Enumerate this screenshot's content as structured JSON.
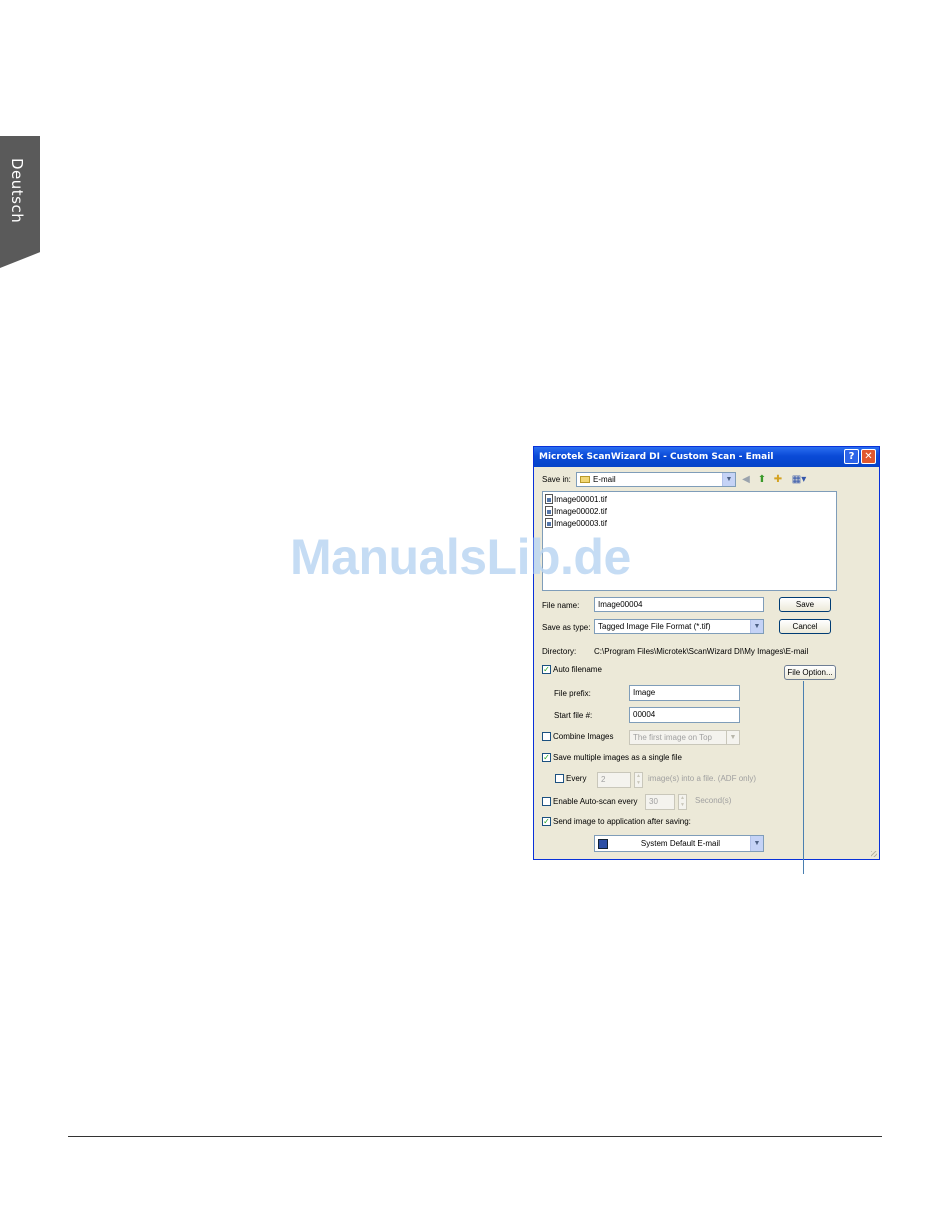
{
  "side_tab": {
    "label": "Deutsch"
  },
  "watermark": "ManualsLib.de",
  "dialog": {
    "title": "Microtek ScanWizard DI - Custom Scan - Email",
    "help_label": "?",
    "close_label": "✕",
    "save_in_label": "Save in:",
    "save_in_value": "E-mail",
    "files": [
      "Image00001.tif",
      "Image00002.tif",
      "Image00003.tif"
    ],
    "file_name_label": "File name:",
    "file_name_value": "Image00004",
    "save_button": "Save",
    "save_as_type_label": "Save as type:",
    "save_as_type_value": "Tagged Image File Format (*.tif)",
    "cancel_button": "Cancel",
    "directory_label": "Directory:",
    "directory_value": "C:\\Program Files\\Microtek\\ScanWizard DI\\My Images\\E-mail",
    "auto_filename_label": "Auto filename",
    "auto_filename_checked": true,
    "file_option_button": "File Option...",
    "file_prefix_label": "File prefix:",
    "file_prefix_value": "Image",
    "start_file_label": "Start file #:",
    "start_file_value": "00004",
    "combine_images_label": "Combine Images",
    "combine_images_checked": false,
    "combine_images_value": "The first image on Top",
    "save_multiple_label": "Save multiple images as a single file",
    "save_multiple_checked": true,
    "every_label": "Every",
    "every_checked": false,
    "every_value": "2",
    "every_suffix": "image(s) into a file. (ADF only)",
    "auto_scan_label": "Enable Auto-scan every",
    "auto_scan_checked": false,
    "auto_scan_value": "30",
    "auto_scan_suffix": "Second(s)",
    "send_image_label": "Send image to application after saving:",
    "send_image_checked": true,
    "application_value": "System Default E-mail"
  }
}
